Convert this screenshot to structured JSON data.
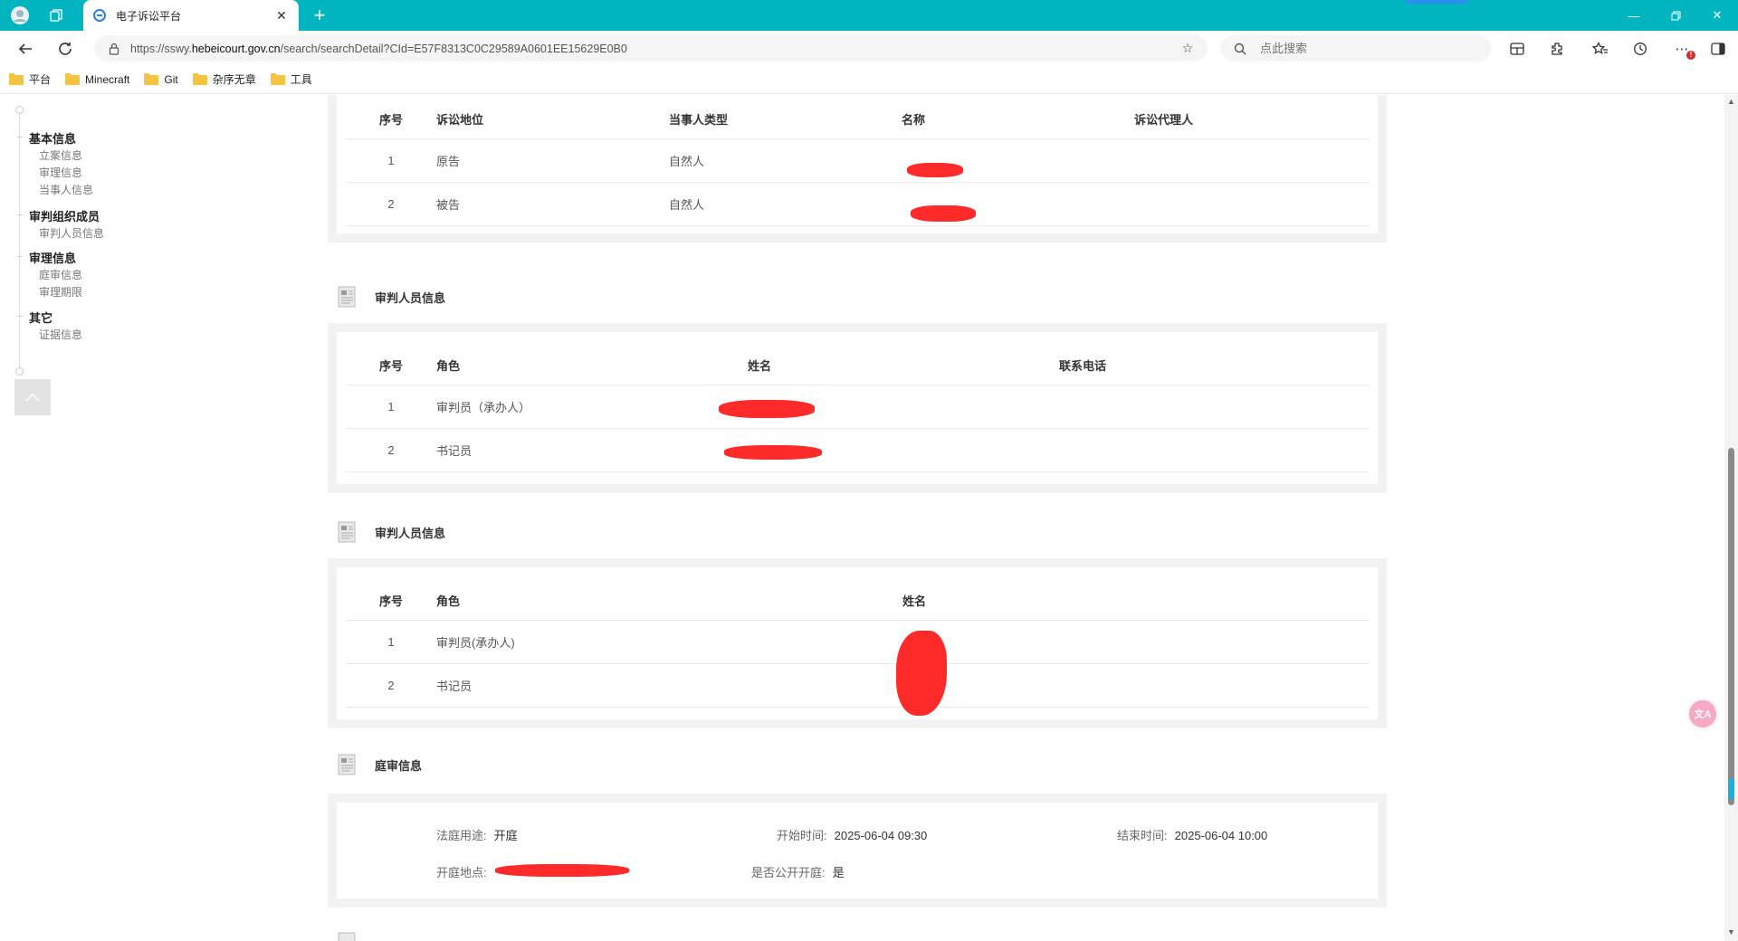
{
  "browser": {
    "tab_title": "电子诉讼平台",
    "url_prefix": "https://sswy.",
    "url_domain": "hebeicourt.gov.cn",
    "url_path": "/search/searchDetail?CId=E57F8313C0C29589A0601EE15629E0B0",
    "search_placeholder": "点此搜索"
  },
  "bookmarks": [
    "平台",
    "Minecraft",
    "Git",
    "杂序无章",
    "工具"
  ],
  "sidenav": {
    "groups": [
      {
        "label": "基本信息",
        "items": [
          "立案信息",
          "审理信息",
          "当事人信息"
        ]
      },
      {
        "label": "审判组织成员",
        "items": [
          "审判人员信息"
        ]
      },
      {
        "label": "审理信息",
        "items": [
          "庭审信息",
          "审理期限"
        ]
      },
      {
        "label": "其它",
        "items": [
          "证据信息"
        ]
      }
    ]
  },
  "parties": {
    "headers": [
      "序号",
      "诉讼地位",
      "当事人类型",
      "名称",
      "诉讼代理人"
    ],
    "rows": [
      {
        "idx": "1",
        "status": "原告",
        "type": "自然人"
      },
      {
        "idx": "2",
        "status": "被告",
        "type": "自然人"
      }
    ]
  },
  "judges_a": {
    "title": "审判人员信息",
    "headers": [
      "序号",
      "角色",
      "姓名",
      "联系电话"
    ],
    "rows": [
      {
        "idx": "1",
        "role": "审判员（承办人）"
      },
      {
        "idx": "2",
        "role": "书记员"
      }
    ]
  },
  "judges_b": {
    "title": "审判人员信息",
    "headers": [
      "序号",
      "角色",
      "姓名"
    ],
    "rows": [
      {
        "idx": "1",
        "role": "审判员(承办人)"
      },
      {
        "idx": "2",
        "role": "书记员"
      }
    ]
  },
  "hearing": {
    "title": "庭审信息",
    "purpose_label": "法庭用途:",
    "purpose": "开庭",
    "start_label": "开始时间:",
    "start": "2025-06-04 09:30",
    "end_label": "结束时间:",
    "end": "2025-06-04 10:00",
    "location_label": "开庭地点:",
    "public_label": "是否公开开庭:",
    "public": "是"
  },
  "colors": {
    "tabbar": "#00b5c0",
    "redaction": "#ff2b2b",
    "panel_bg": "#f2f2f2"
  }
}
